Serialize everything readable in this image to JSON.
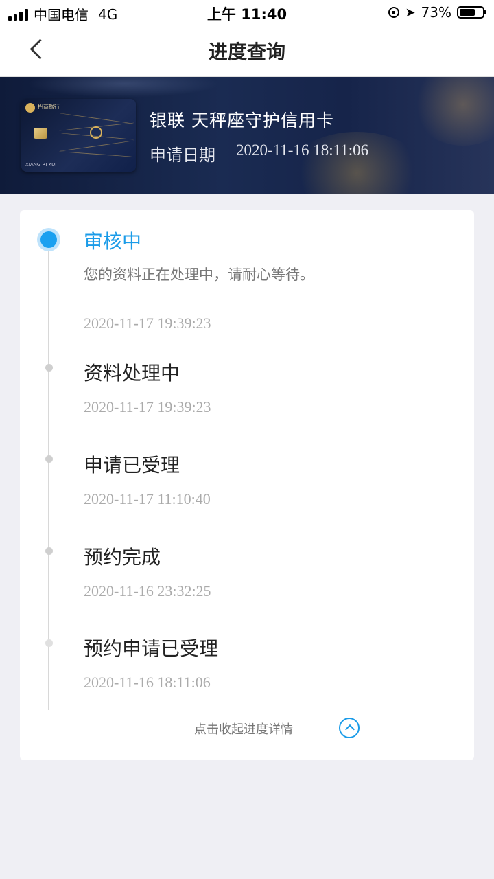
{
  "status_bar": {
    "carrier": "中国电信",
    "network": "4G",
    "time": "上午 11:40",
    "battery_percent": "73%",
    "battery_level": 0.73
  },
  "nav": {
    "title": "进度查询",
    "back_icon": "chevron-left-icon"
  },
  "card": {
    "name": "银联 天秤座守护信用卡",
    "apply_date_label": "申请日期",
    "apply_date": "2020-11-16 18:11:06",
    "image_bank_name": "招商银行",
    "image_holder_name": "XIANG RI KUI"
  },
  "progress": {
    "steps": [
      {
        "title": "审核中",
        "desc": "您的资料正在处理中，请耐心等待。",
        "time": "2020-11-17 19:39:23",
        "current": true
      },
      {
        "title": "资料处理中",
        "time": "2020-11-17 19:39:23"
      },
      {
        "title": "申请已受理",
        "time": "2020-11-17 11:10:40"
      },
      {
        "title": "预约完成",
        "time": "2020-11-16 23:32:25"
      },
      {
        "title": "预约申请已受理",
        "time": "2020-11-16 18:11:06"
      }
    ],
    "collapse_label": "点击收起进度详情",
    "collapse_icon": "chevron-up-circle-icon"
  },
  "colors": {
    "accent": "#1a9be8",
    "banner": "#16244a"
  }
}
